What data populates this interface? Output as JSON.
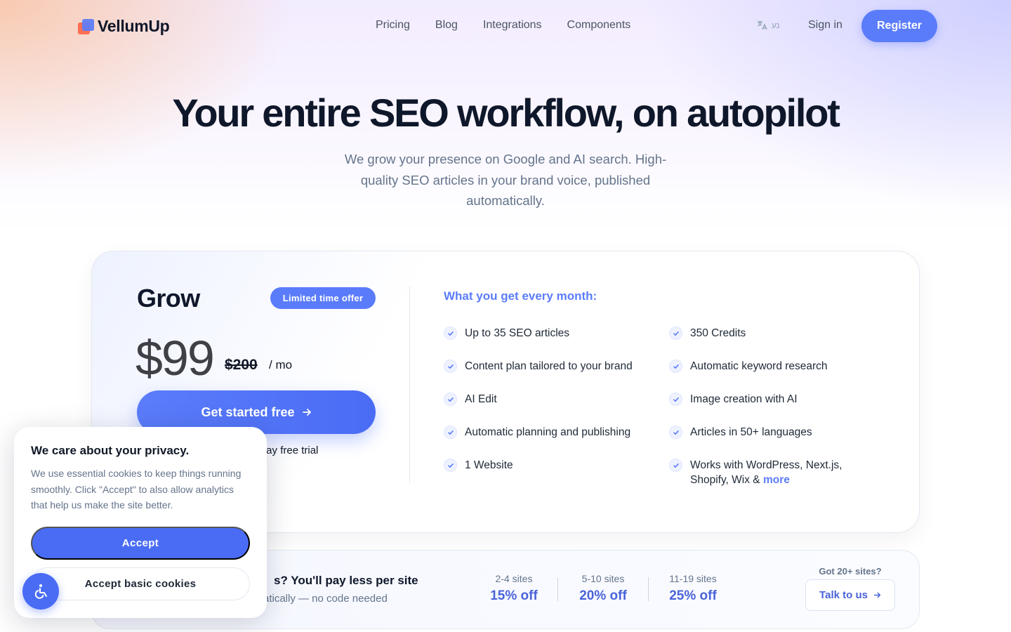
{
  "brand": {
    "name": "VellumUp"
  },
  "nav": {
    "items": [
      "Pricing",
      "Blog",
      "Integrations",
      "Components"
    ]
  },
  "header": {
    "lang_label": "נע",
    "signin": "Sign in",
    "register": "Register"
  },
  "hero": {
    "title": "Your entire SEO workflow, on autopilot",
    "subtitle": "We grow your presence on Google and AI search. High-quality SEO articles in your brand voice, published automatically."
  },
  "plan": {
    "name": "Grow",
    "badge": "Limited time offer",
    "price": "$99",
    "old_price": "$200",
    "period": "/ mo",
    "cta": "Get started free",
    "trial_bold": "d",
    "trial_rest": " · 5-day free trial"
  },
  "features": {
    "title": "What you get every month:",
    "left": [
      "Up to 35 SEO articles",
      "Content plan tailored to your brand",
      "AI Edit",
      "Automatic planning and publishing",
      "1 Website"
    ],
    "right": [
      "350 Credits",
      "Automatic keyword research",
      "Image creation with AI",
      "Articles in 50+ languages"
    ],
    "last_text": "Works with WordPress, Next.js, Shopify, Wix & ",
    "last_link": "more"
  },
  "discounts": {
    "title": "s? You'll pay less per site",
    "subtitle": "atically — no code needed",
    "tiers": [
      {
        "sites": "2-4 sites",
        "off": "15% off"
      },
      {
        "sites": "5-10 sites",
        "off": "20% off"
      },
      {
        "sites": "11-19 sites",
        "off": "25% off"
      }
    ],
    "more_label": "Got 20+ sites?",
    "talk": "Talk to us"
  },
  "cookie": {
    "title": "We care about your privacy.",
    "text": "We use essential cookies to keep things running smoothly. Click \"Accept\" to also allow analytics that help us make the site better.",
    "accept": "Accept",
    "accept_basic": "Accept basic cookies"
  },
  "colors": {
    "accent": "#5b7cfa",
    "accent_dark": "#4a63d9",
    "text": "#0f172a",
    "muted": "#64748b"
  }
}
